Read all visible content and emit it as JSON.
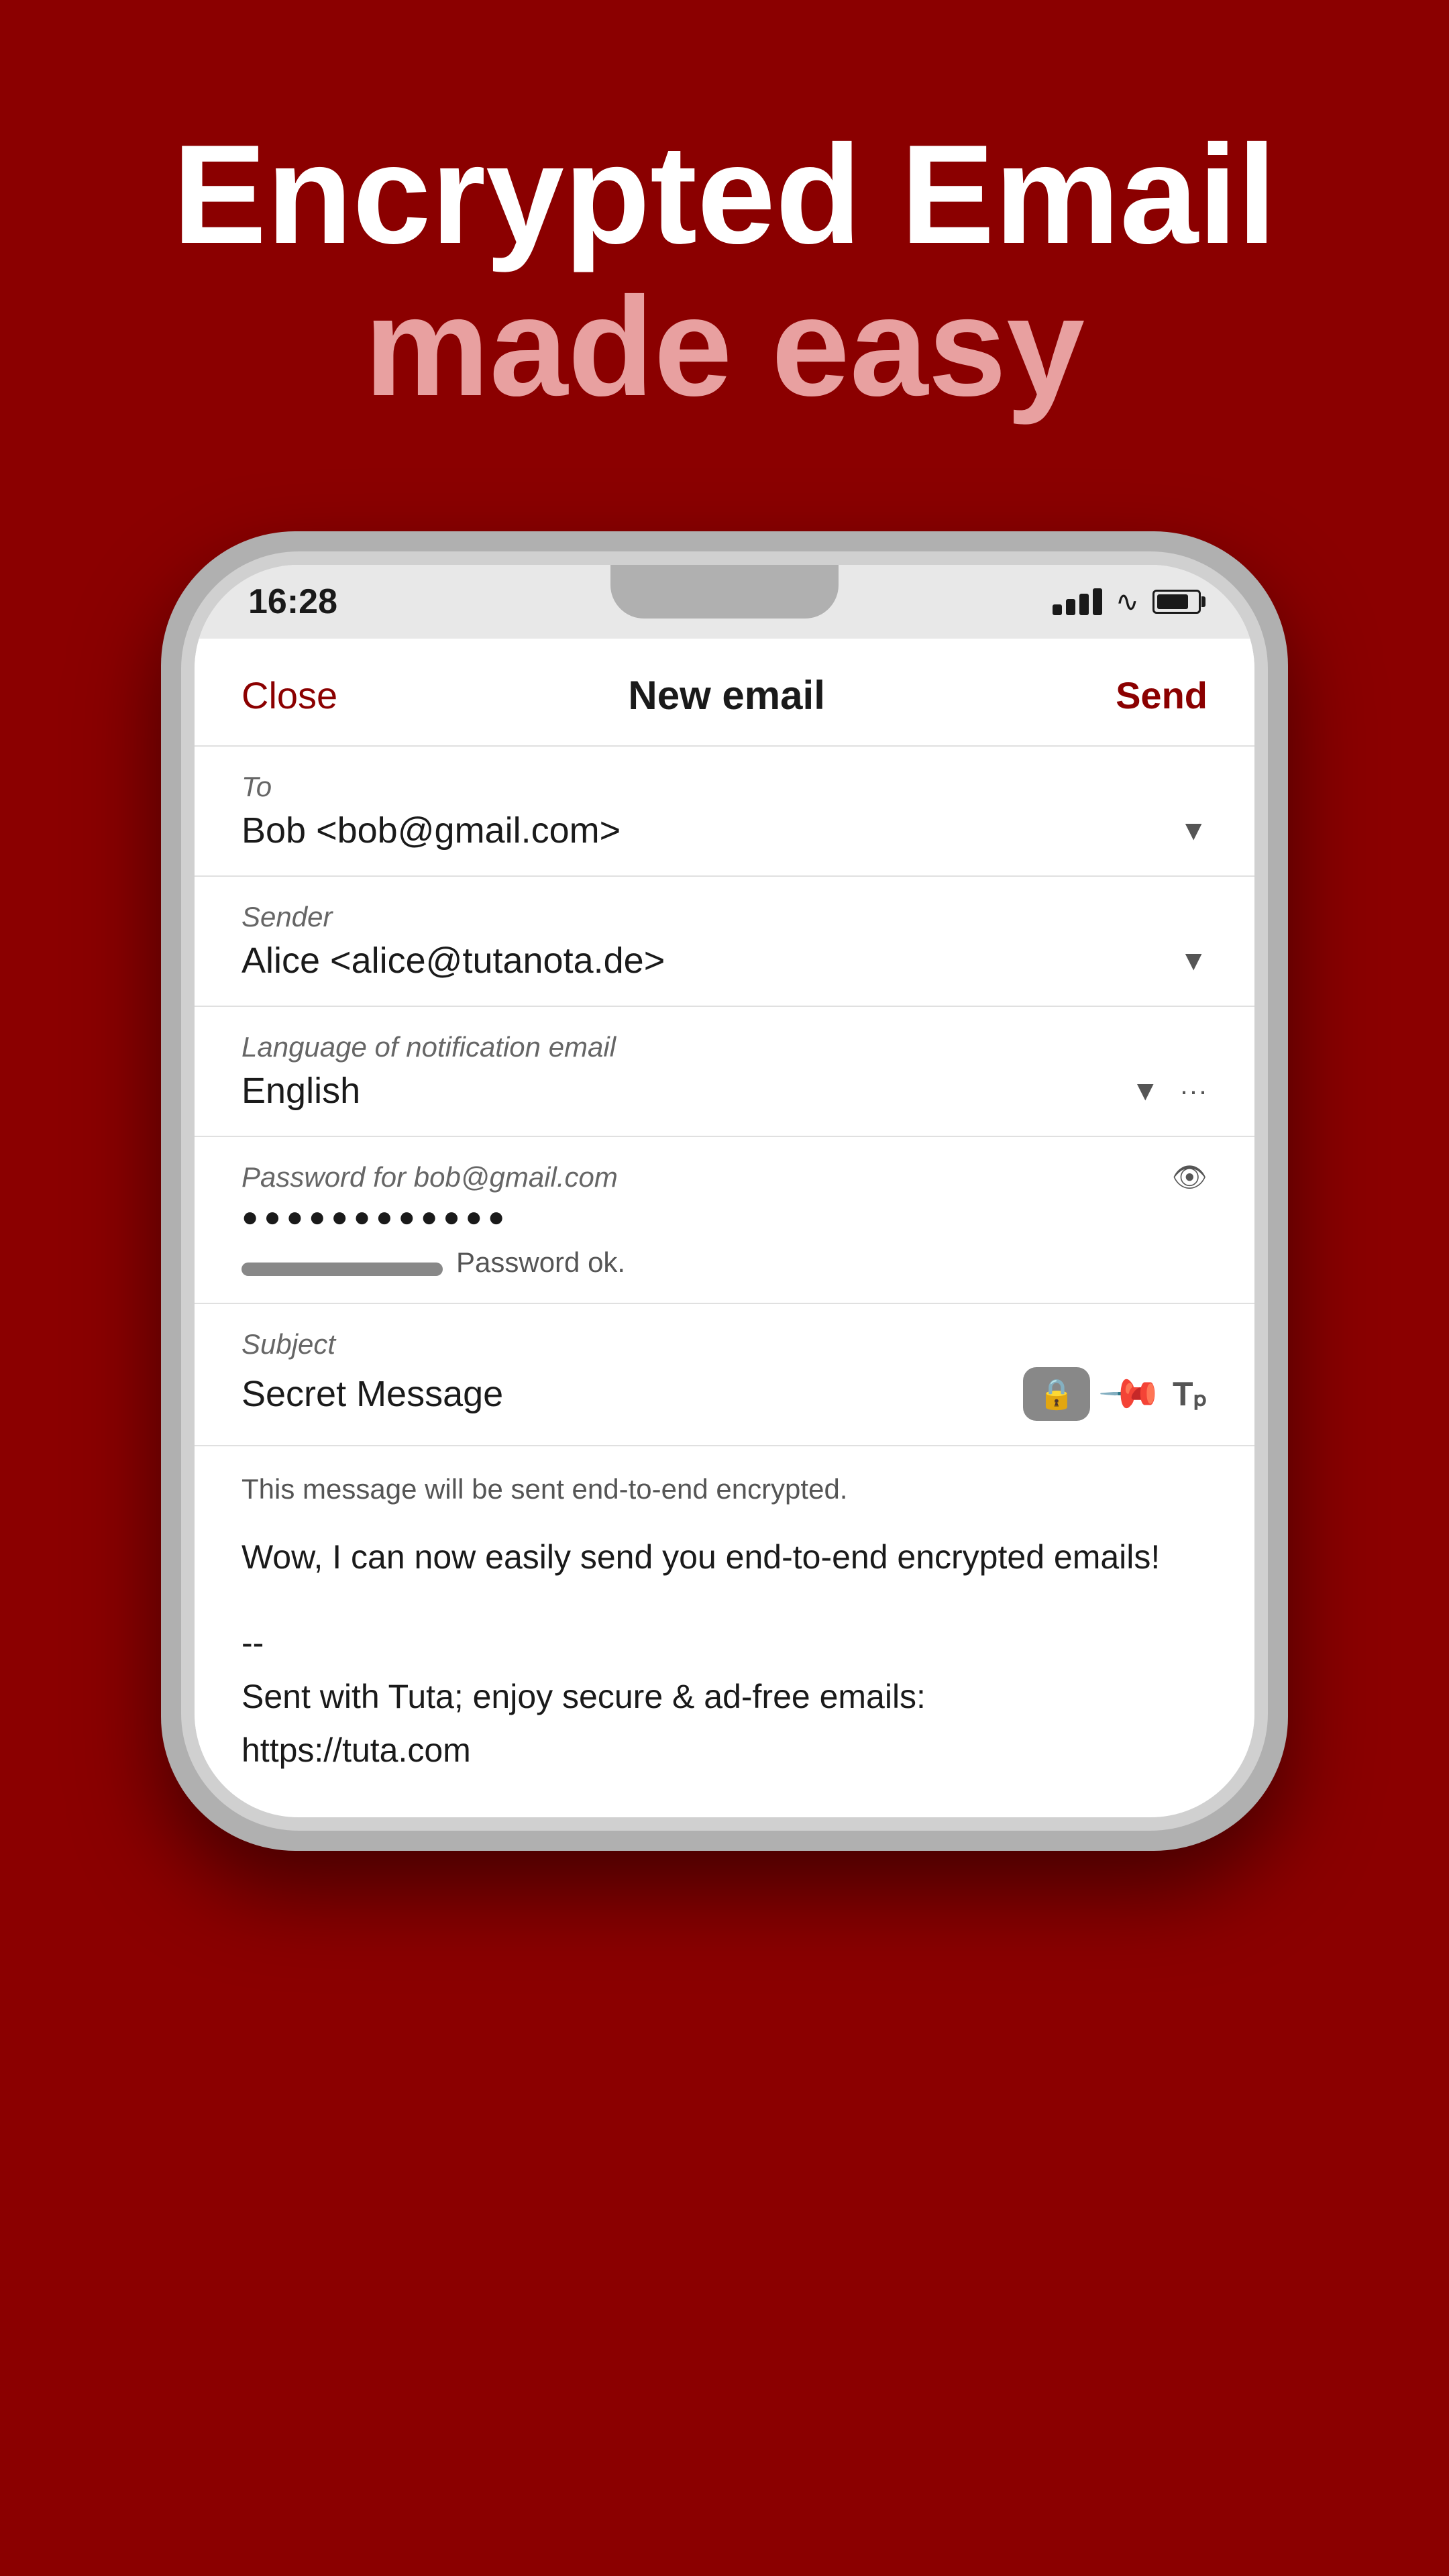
{
  "hero": {
    "title_main": "Encrypted Email",
    "title_sub": "made easy"
  },
  "phone": {
    "status_bar": {
      "time": "16:28"
    },
    "compose": {
      "close_label": "Close",
      "title_label": "New email",
      "send_label": "Send",
      "to_label": "To",
      "to_value": "Bob <bob@gmail.com>",
      "sender_label": "Sender",
      "sender_value": "Alice <alice@tutanota.de>",
      "notification_lang_label": "Language of notification email",
      "notification_lang_value": "English",
      "password_label": "Password for bob@gmail.com",
      "password_dots": "●●●●●●●●●●●●",
      "password_ok_text": "Password ok.",
      "subject_label": "Subject",
      "subject_value": "Secret Message",
      "encrypted_notice": "This message will be sent end-to-end encrypted.",
      "body_text": "Wow, I can now easily send you end-to-end encrypted emails!",
      "signature_line1": "--",
      "signature_line2": "Sent with Tuta; enjoy secure & ad-free emails:",
      "signature_line3": "https://tuta.com"
    }
  }
}
